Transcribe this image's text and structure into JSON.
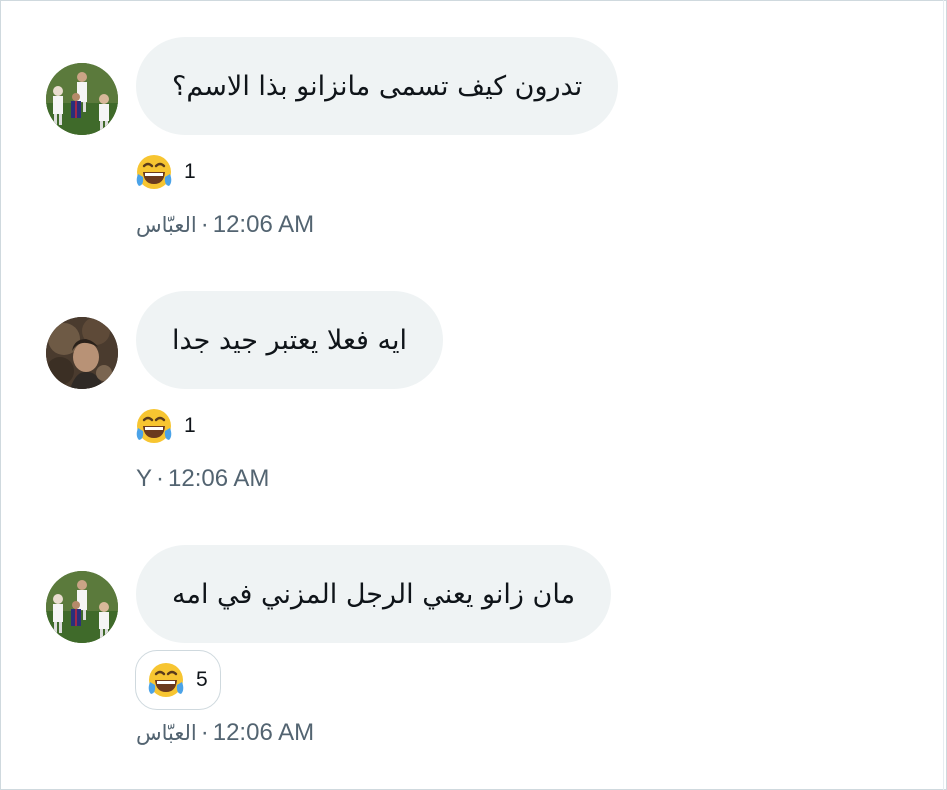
{
  "messages": [
    {
      "text": "تدرون كيف تسمى مانزانو بذا الاسم؟",
      "reaction": {
        "emoji": "face-with-tears-of-joy",
        "count": "1"
      },
      "sender": "العبّاس",
      "separator": "·",
      "time": "12:06 AM",
      "avatar": "football-players-avatar"
    },
    {
      "text": "ايه فعلا يعتبر جيد جدا",
      "reaction": {
        "emoji": "face-with-tears-of-joy",
        "count": "1"
      },
      "sender": "Y",
      "separator": "·",
      "time": "12:06 AM",
      "avatar": "person-photo-avatar"
    },
    {
      "text": "مان زانو يعني الرجل المزني في امه",
      "reaction": {
        "emoji": "face-with-tears-of-joy",
        "count": "5"
      },
      "sender": "العبّاس",
      "separator": "·",
      "time": "12:06 AM",
      "avatar": "football-players-avatar"
    }
  ],
  "colors": {
    "bubble": "#eff3f4",
    "secondary_text": "#536471",
    "primary_text": "#0f1419",
    "border": "#cfd9de"
  }
}
